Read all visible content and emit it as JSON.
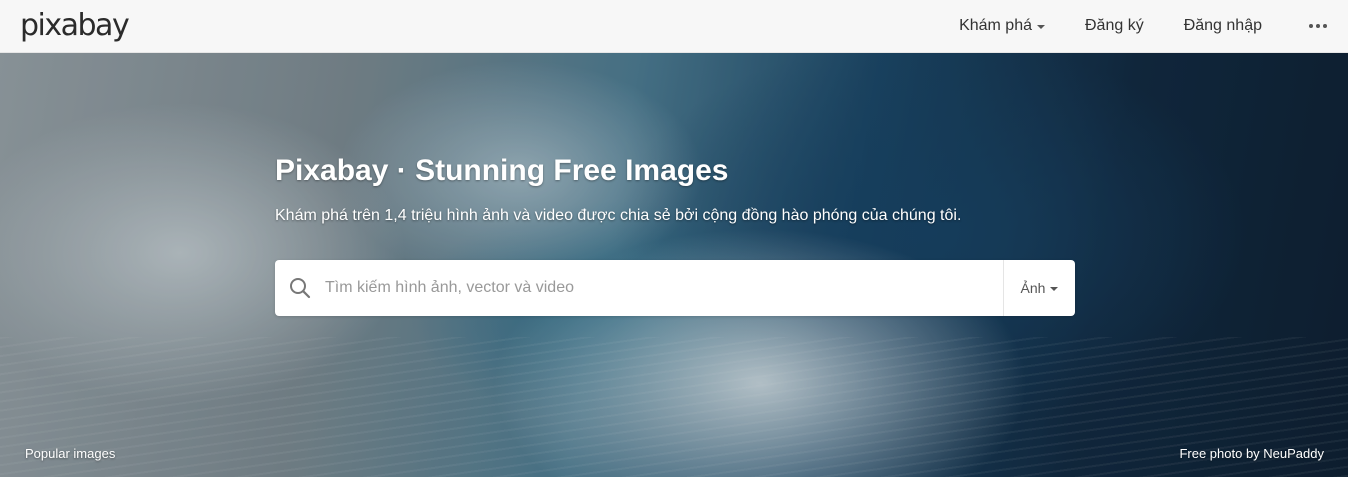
{
  "header": {
    "logo_text": "pixabay",
    "nav": {
      "explore_label": "Khám phá",
      "register_label": "Đăng ký",
      "login_label": "Đăng nhập",
      "more_icon": "more-dots-icon"
    }
  },
  "hero": {
    "title": "Pixabay · Stunning Free Images",
    "subtitle": "Khám phá trên 1,4 triệu hình ảnh và video được chia sẻ bởi cộng đồng hào phóng của chúng tôi.",
    "search": {
      "placeholder": "Tìm kiếm hình ảnh, vector và video",
      "value": "",
      "icon": "search-icon",
      "type_selected": "Ảnh"
    },
    "popular_label": "Popular images",
    "credit_label": "Free photo by NeuPaddy"
  },
  "colors": {
    "topbar_bg": "#f7f7f7",
    "text_dark": "#333333",
    "hero_text": "#ffffff"
  }
}
